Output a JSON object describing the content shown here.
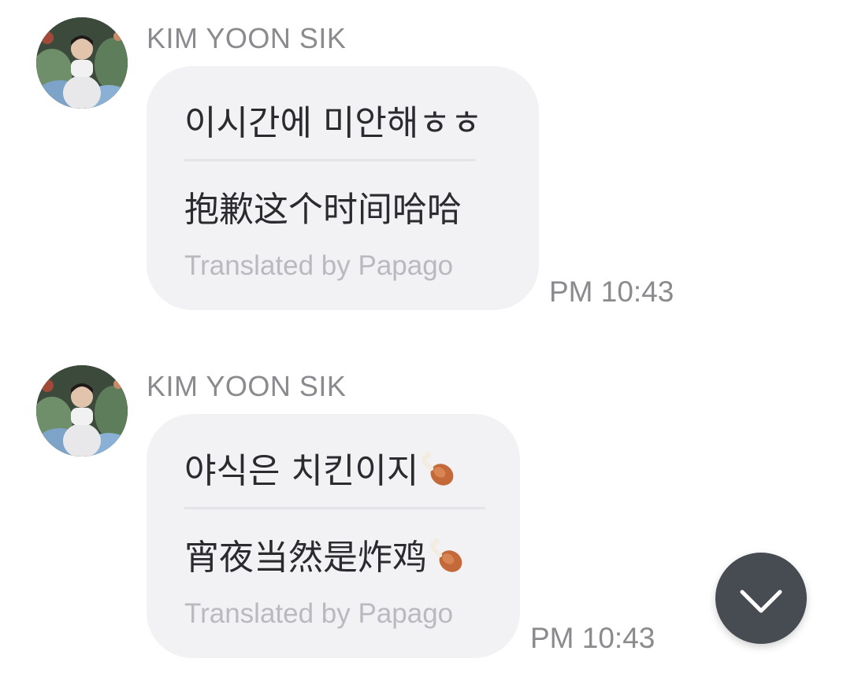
{
  "messages": [
    {
      "sender": "KIM YOON SIK",
      "original": "이시간에 미안해ㅎㅎ",
      "translated": "抱歉这个时间哈哈",
      "credit": "Translated by Papago",
      "time": "PM 10:43"
    },
    {
      "sender": "KIM YOON SIK",
      "original": "야식은 치킨이지",
      "original_emoji": "drumstick-icon",
      "translated": "宵夜当然是炸鸡",
      "translated_emoji": "drumstick-icon",
      "credit": "Translated by Papago",
      "time": "PM 10:43"
    }
  ],
  "scroll_button": {
    "icon": "chevron-down-icon"
  },
  "colors": {
    "bubble": "#f2f2f5",
    "text": "#2b2b2f",
    "meta": "#8a8a8f",
    "credit": "#b9b9c0",
    "scroll_button": "#474b52"
  }
}
